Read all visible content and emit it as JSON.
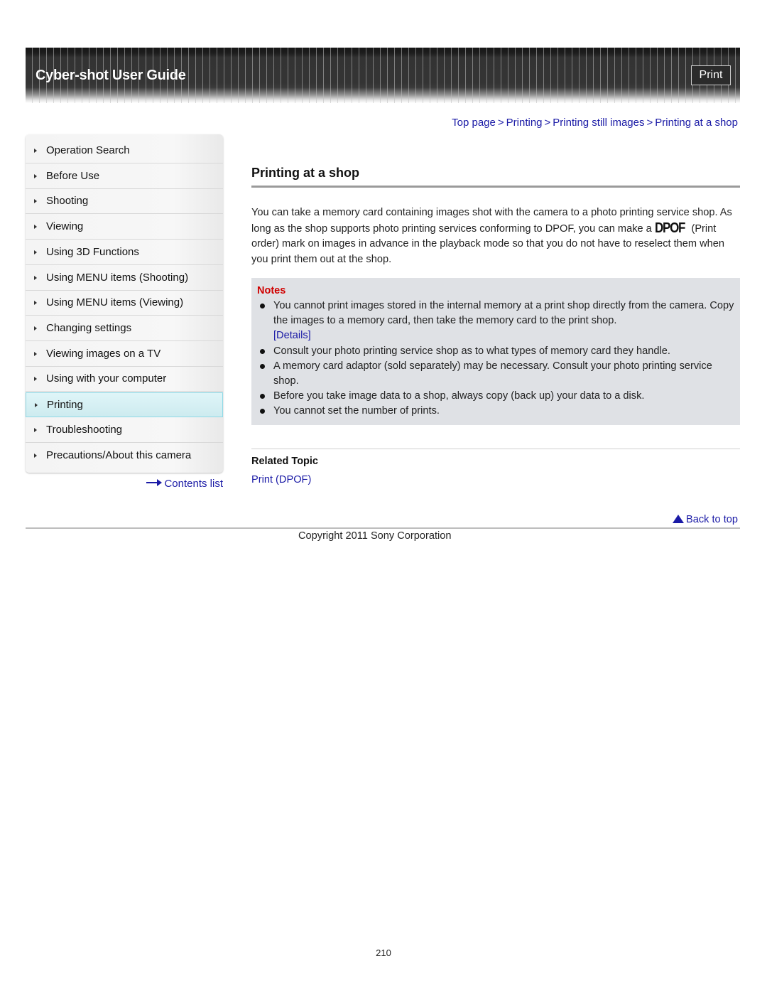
{
  "header": {
    "title": "Cyber-shot User Guide",
    "print_label": "Print"
  },
  "breadcrumb": {
    "items": [
      "Top page",
      "Printing",
      "Printing still images",
      "Printing at a shop"
    ],
    "separator": ">"
  },
  "sidebar": {
    "items": [
      {
        "label": "Operation Search",
        "active": false
      },
      {
        "label": "Before Use",
        "active": false
      },
      {
        "label": "Shooting",
        "active": false
      },
      {
        "label": "Viewing",
        "active": false
      },
      {
        "label": "Using 3D Functions",
        "active": false
      },
      {
        "label": "Using MENU items (Shooting)",
        "active": false
      },
      {
        "label": "Using MENU items (Viewing)",
        "active": false
      },
      {
        "label": "Changing settings",
        "active": false
      },
      {
        "label": "Viewing images on a TV",
        "active": false
      },
      {
        "label": "Using with your computer",
        "active": false
      },
      {
        "label": "Printing",
        "active": true
      },
      {
        "label": "Troubleshooting",
        "active": false
      },
      {
        "label": "Precautions/About this camera",
        "active": false
      }
    ],
    "contents_link": "Contents list"
  },
  "main": {
    "title": "Printing at a shop",
    "intro_part1": "You can take a memory card containing images shot with the camera to a photo printing service shop. As long as the shop supports photo printing services conforming to DPOF, you can make a ",
    "dpof_icon_text": "DPOF",
    "intro_part2": " (Print order) mark on images in advance in the playback mode so that you do not have to reselect them when you print them out at the shop.",
    "notes": {
      "title": "Notes",
      "items": [
        {
          "text": "You cannot print images stored in the internal memory at a print shop directly from the camera. Copy the images to a memory card, then take the memory card to the print shop.",
          "link": "[Details]"
        },
        {
          "text": "Consult your photo printing service shop as to what types of memory card they handle."
        },
        {
          "text": "A memory card adaptor (sold separately) may be necessary. Consult your photo printing service shop."
        },
        {
          "text": "Before you take image data to a shop, always copy (back up) your data to a disk."
        },
        {
          "text": "You cannot set the number of prints."
        }
      ]
    },
    "related": {
      "title": "Related Topic",
      "links": [
        "Print (DPOF)"
      ]
    }
  },
  "footer": {
    "back_to_top": "Back to top",
    "copyright": "Copyright 2011 Sony Corporation",
    "page_number": "210"
  },
  "colors": {
    "link": "#1a1aa6",
    "notes_title": "#d00000",
    "notes_background": "#dfe1e5",
    "active_item": "#cdebef"
  }
}
